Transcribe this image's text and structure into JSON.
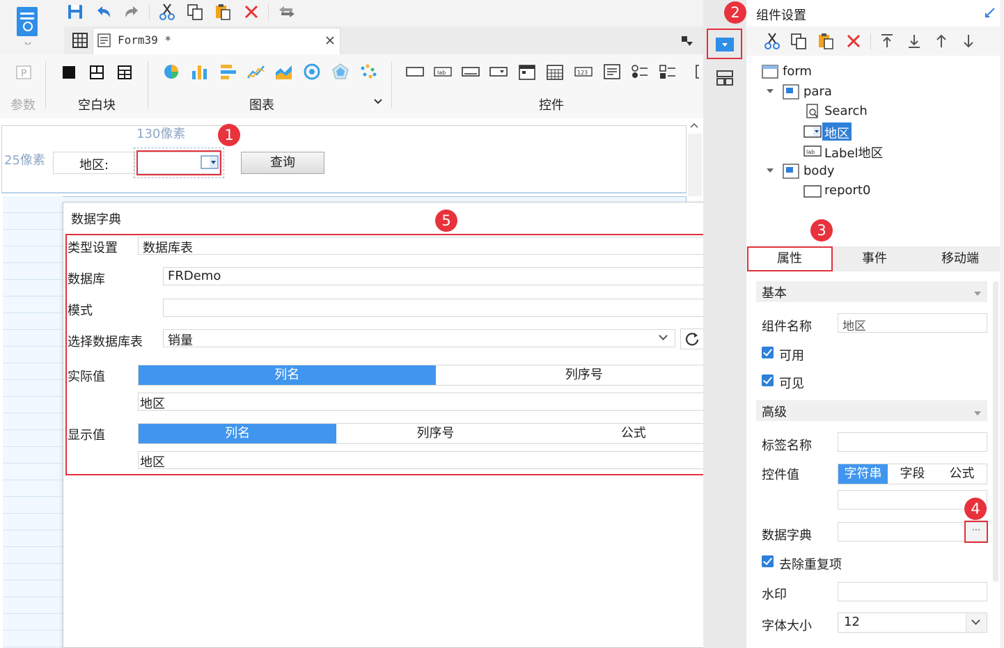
{
  "toolbar": {
    "tab_title": "Form39 *",
    "groups": {
      "param": "参数",
      "blank": "空白块",
      "chart": "图表",
      "widget": "控件"
    }
  },
  "canvas": {
    "width_hint": "130像素",
    "height_hint": "25像素",
    "field_label": "地区:",
    "query_button": "查询"
  },
  "dialog": {
    "title": "数据字典",
    "type_label": "类型设置",
    "type_value": "数据库表",
    "db_label": "数据库",
    "db_value": "FRDemo",
    "schema_label": "模式",
    "schema_value": "",
    "table_label": "选择数据库表",
    "table_value": "销量",
    "actual_label": "实际值",
    "actual_tabs": [
      "列名",
      "列序号"
    ],
    "actual_value": "地区",
    "display_label": "显示值",
    "display_tabs": [
      "列名",
      "列序号",
      "公式"
    ],
    "display_value": "地区"
  },
  "panel": {
    "title": "组件设置",
    "tree": {
      "form": "form",
      "para": "para",
      "search": "Search",
      "region": "地区",
      "label_region": "Label地区",
      "body": "body",
      "report": "report0"
    },
    "tabs": [
      "属性",
      "事件",
      "移动端"
    ],
    "basic_header": "基本",
    "name_label": "组件名称",
    "name_value": "地区",
    "enabled": "可用",
    "visible": "可见",
    "advanced_header": "高级",
    "tag_label": "标签名称",
    "tag_value": "",
    "ctrl_value_label": "控件值",
    "ctrl_value_tabs": [
      "字符串",
      "字段",
      "公式"
    ],
    "ctrl_value": "",
    "dict_label": "数据字典",
    "dict_btn": "···",
    "dedupe": "去除重复项",
    "watermark_label": "水印",
    "watermark_value": "",
    "font_size_label": "字体大小",
    "font_size_value": "12"
  },
  "markers": [
    "1",
    "2",
    "3",
    "4",
    "5"
  ],
  "colors": {
    "accent": "#4096ee",
    "marker": "#e8323c",
    "selection": "#2f80d8"
  }
}
